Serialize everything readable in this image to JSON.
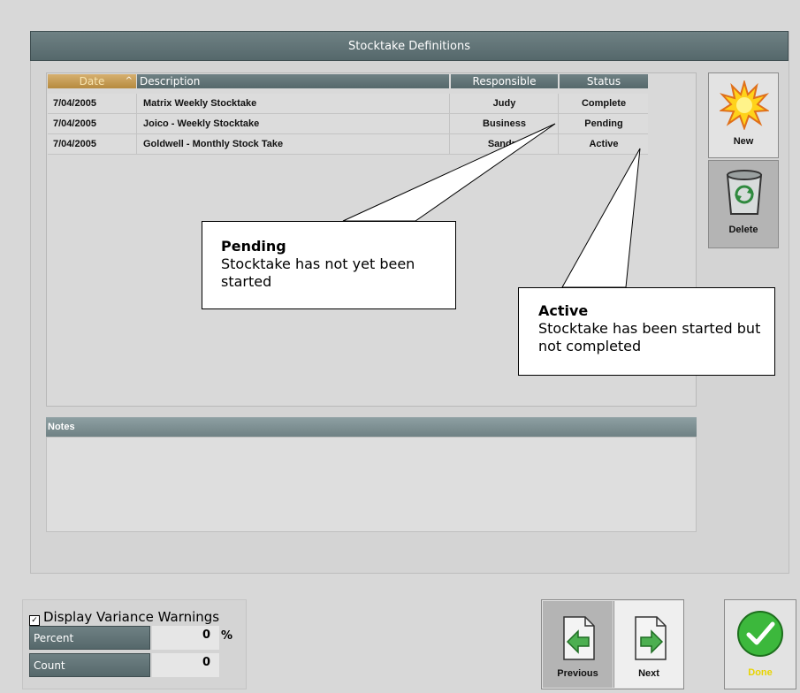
{
  "window": {
    "title": "Stocktake Definitions"
  },
  "grid": {
    "columns": [
      {
        "key": "date",
        "label": "Date",
        "sorted": "ascending"
      },
      {
        "key": "description",
        "label": "Description"
      },
      {
        "key": "responsible",
        "label": "Responsible"
      },
      {
        "key": "status",
        "label": "Status"
      }
    ],
    "rows": [
      {
        "date": "7/04/2005",
        "description": "Matrix Weekly Stocktake",
        "responsible": "Judy",
        "status": "Complete"
      },
      {
        "date": "7/04/2005",
        "description": "Joico - Weekly Stocktake",
        "responsible": "Business",
        "status": "Pending"
      },
      {
        "date": "7/04/2005",
        "description": "Goldwell - Monthly Stock Take",
        "responsible": "Sandra",
        "status": "Active"
      }
    ]
  },
  "side_buttons": {
    "new_label": "New",
    "delete_label": "Delete",
    "new_icon": "starburst-icon",
    "delete_icon": "recycle-bin-icon"
  },
  "notes": {
    "label": "Notes",
    "value": ""
  },
  "callouts": {
    "pending": {
      "title": "Pending",
      "text": "Stocktake has not yet been started"
    },
    "active": {
      "title": "Active",
      "text": "Stocktake has been started but not completed"
    }
  },
  "variance": {
    "checkbox_label": "Display Variance Warnings",
    "checked": true,
    "percent_label": "Percent",
    "percent_value": "0",
    "percent_unit": "%",
    "count_label": "Count",
    "count_value": "0"
  },
  "nav": {
    "previous_label": "Previous",
    "next_label": "Next",
    "done_label": "Done"
  },
  "colors": {
    "header": "#5f7275",
    "date_header": "#c9a05a",
    "done_green": "#3cb83c",
    "arrow_green": "#4caf50"
  }
}
